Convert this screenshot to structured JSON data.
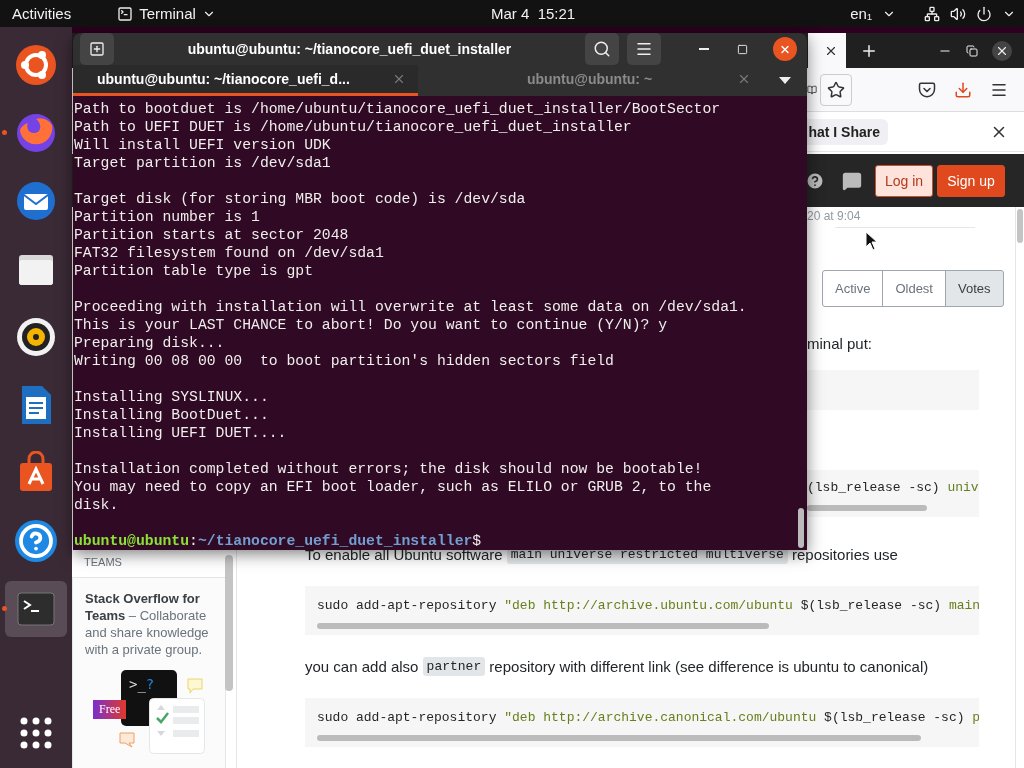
{
  "top_bar": {
    "activities": "Activities",
    "app_menu": "Terminal",
    "clock": "Mar 4  15:21",
    "input_source": "en₁"
  },
  "dock": [
    {
      "kind": "ubuntu",
      "running": false,
      "selected": false
    },
    {
      "kind": "firefox",
      "running": true,
      "selected": false
    },
    {
      "kind": "thunderbird",
      "running": false,
      "selected": false
    },
    {
      "kind": "files",
      "running": false,
      "selected": false
    },
    {
      "kind": "rhythmbox",
      "running": false,
      "selected": false
    },
    {
      "kind": "writer",
      "running": false,
      "selected": false
    },
    {
      "kind": "software",
      "running": false,
      "selected": false
    },
    {
      "kind": "help",
      "running": false,
      "selected": false
    },
    {
      "kind": "terminal",
      "running": true,
      "selected": true
    }
  ],
  "terminal": {
    "title": "ubuntu@ubuntu: ~/tianocore_uefi_duet_installer",
    "tabs": [
      {
        "label": "ubuntu@ubuntu: ~/tianocore_uefi_d...",
        "selected": true
      },
      {
        "label": "ubuntu@ubuntu: ~",
        "selected": false
      }
    ],
    "blocks": [
      [
        "Path to bootduet is /home/ubuntu/tianocore_uefi_duet_installer/BootSector",
        "Path to UEFI DUET is /home/ubuntu/tianocore_uefi_duet_installer",
        "Will install UEFI version UDK",
        "Target partition is /dev/sda1"
      ],
      [
        "Target disk (for storing MBR boot code) is /dev/sda",
        "Partition number is 1",
        "Partition starts at sector 2048",
        "FAT32 filesystem found on /dev/sda1",
        "Partition table type is gpt"
      ],
      [
        "Proceeding with installation will overwrite at least some data on /dev/sda1.",
        "This is your LAST CHANCE to abort! Do you want to continue (Y/N)? y",
        "Preparing disk...",
        "Writing 00 08 00 00  to boot partition's hidden sectors field"
      ],
      [
        "Installing SYSLINUX...",
        "Installing BootDuet...",
        "Installing UEFI DUET...."
      ],
      [
        "Installation completed without errors; the disk should now be bootable!",
        "You may need to copy an EFI boot loader, such as ELILO or GRUB 2, to the",
        "disk."
      ]
    ],
    "prompt": {
      "user_host": "ubuntu@ubuntu",
      "separator": ":",
      "path": "~/tianocore_uefi_duet_installer",
      "symbol": "$"
    }
  },
  "browser": {
    "notification": "hat I Share",
    "header": {
      "login": "Log in",
      "signup": "Sign up"
    },
    "sidebar": {
      "heading": "TEAMS",
      "promo": "**Stack Overflow for Teams** – Collaborate and share knowledge with a private group.",
      "illustration_prompt": ">_",
      "illustration_mark": "?",
      "badge": "Free"
    },
    "answer": {
      "date_fragment": "20 at 9:04",
      "sort_options": [
        {
          "label": "Active",
          "selected": false
        },
        {
          "label": "Oldest",
          "selected": false
        },
        {
          "label": "Votes",
          "selected": true
        }
      ],
      "fragment": "minal put:",
      "code_fragment": [
        {
          "kind": "plain",
          "text": "(lsb_release -sc) "
        },
        {
          "kind": "string",
          "text": "univ"
        }
      ],
      "blocks": [
        {
          "kind": "paragraph",
          "parts": [
            {
              "kind": "text",
              "text": "To enable all Ubuntu software "
            },
            {
              "kind": "code",
              "text": "main universe restricted multiverse"
            },
            {
              "kind": "text",
              "text": " repositories use"
            }
          ]
        },
        {
          "kind": "code",
          "parts": [
            {
              "kind": "plain",
              "text": "sudo add-apt-repository "
            },
            {
              "kind": "string",
              "text": "\"deb http://archive.ubuntu.com/ubuntu"
            },
            {
              "kind": "plain",
              "text": " $(lsb_release -sc) "
            },
            {
              "kind": "string",
              "text": "main"
            }
          ]
        },
        {
          "kind": "paragraph",
          "parts": [
            {
              "kind": "text",
              "text": "you can add also "
            },
            {
              "kind": "code",
              "text": "partner"
            },
            {
              "kind": "text",
              "text": " repository with different link (see difference is ubuntu to canonical)"
            }
          ]
        },
        {
          "kind": "code",
          "parts": [
            {
              "kind": "plain",
              "text": "sudo add-apt-repository "
            },
            {
              "kind": "string",
              "text": "\"deb http://archive.canonical.com/ubuntu"
            },
            {
              "kind": "plain",
              "text": " $(lsb_release -sc) "
            },
            {
              "kind": "string",
              "text": "p"
            }
          ]
        }
      ]
    }
  }
}
